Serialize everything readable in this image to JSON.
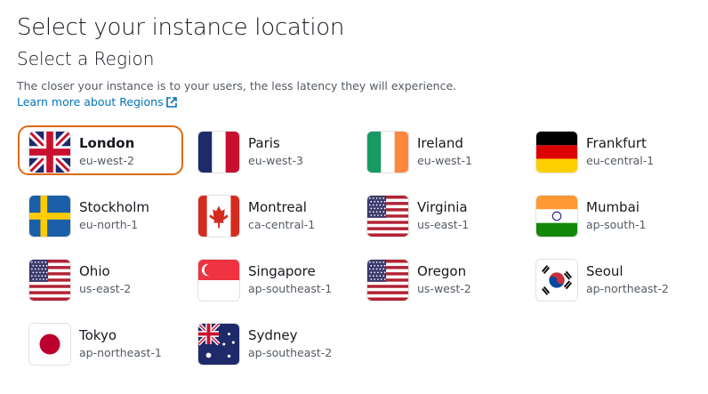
{
  "title": "Select your instance location",
  "subtitle": "Select a Region",
  "description": "The closer your instance is to your users, the less latency they will experience.",
  "learn_more": "Learn more about Regions",
  "accent": "#dd6b10",
  "regions": [
    {
      "name": "London",
      "code": "eu-west-2",
      "flag": "uk",
      "selected": true
    },
    {
      "name": "Paris",
      "code": "eu-west-3",
      "flag": "fr"
    },
    {
      "name": "Ireland",
      "code": "eu-west-1",
      "flag": "ie"
    },
    {
      "name": "Frankfurt",
      "code": "eu-central-1",
      "flag": "de"
    },
    {
      "name": "Stockholm",
      "code": "eu-north-1",
      "flag": "se"
    },
    {
      "name": "Montreal",
      "code": "ca-central-1",
      "flag": "ca"
    },
    {
      "name": "Virginia",
      "code": "us-east-1",
      "flag": "us"
    },
    {
      "name": "Mumbai",
      "code": "ap-south-1",
      "flag": "in"
    },
    {
      "name": "Ohio",
      "code": "us-east-2",
      "flag": "us"
    },
    {
      "name": "Singapore",
      "code": "ap-southeast-1",
      "flag": "sg"
    },
    {
      "name": "Oregon",
      "code": "us-west-2",
      "flag": "us"
    },
    {
      "name": "Seoul",
      "code": "ap-northeast-2",
      "flag": "kr"
    },
    {
      "name": "Tokyo",
      "code": "ap-northeast-1",
      "flag": "jp"
    },
    {
      "name": "Sydney",
      "code": "ap-southeast-2",
      "flag": "au"
    }
  ]
}
